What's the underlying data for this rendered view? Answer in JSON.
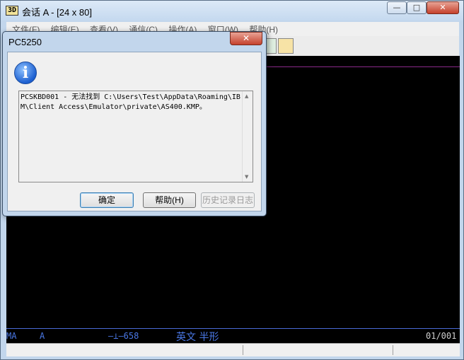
{
  "window": {
    "title": "会话 A - [24 x 80]",
    "icon": "3270/5250-session-icon",
    "icon_text": "3D",
    "controls": {
      "minimize": "—",
      "maximize": "□",
      "close": "✕"
    }
  },
  "menu": [
    "文件(F)",
    "编辑(E)",
    "查看(V)",
    "通信(C)",
    "操作(A)",
    "窗口(W)",
    "帮助(H)"
  ],
  "statusline": {
    "left": "MA",
    "session": "A",
    "arrow_text": "—⊥—658",
    "mode": "英文 半形",
    "position": "01/001"
  },
  "dialog": {
    "title": "PC5250",
    "close": "✕",
    "icon": "info-icon",
    "icon_glyph": "i",
    "message": "PCSKBD001 - 无法找到 C:\\Users\\Test\\AppData\\Roaming\\IBM\\Client Access\\Emulator\\private\\AS400.KMP。",
    "buttons": {
      "ok": "确定",
      "help": "帮助(H)",
      "history": "历史记录日志"
    }
  },
  "colors": {
    "frame": "#c2d6ec",
    "terminal": "#000000",
    "status_text": "#4a78e6",
    "close_red": "#c5412c"
  }
}
